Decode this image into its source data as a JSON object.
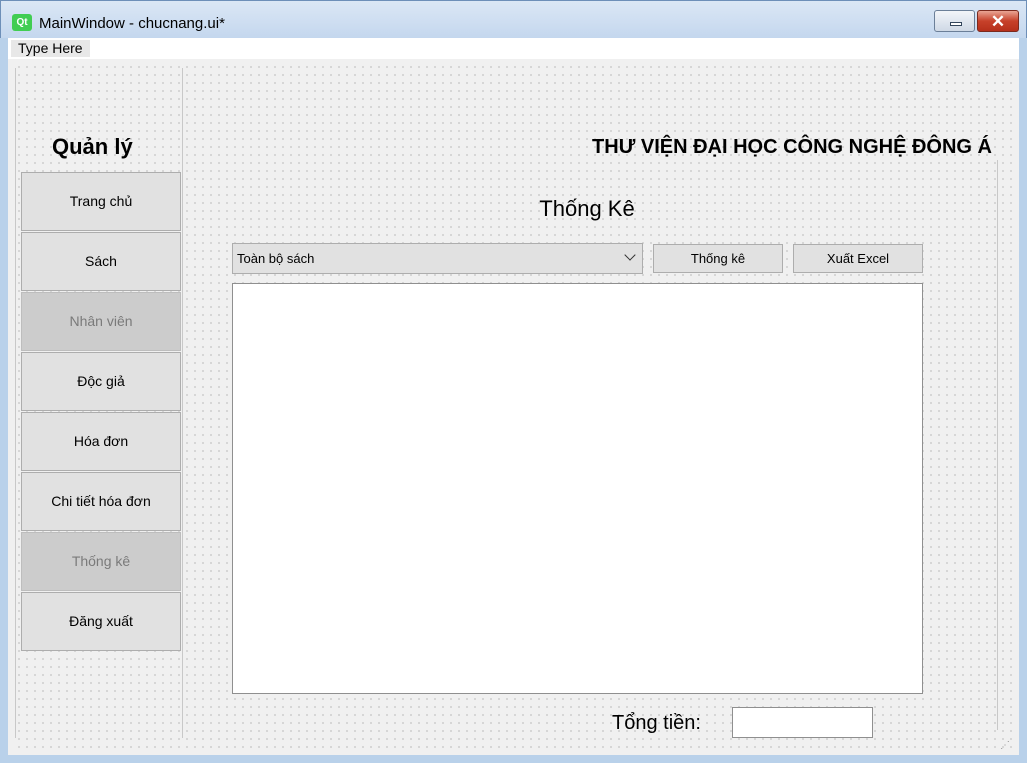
{
  "window": {
    "title": "MainWindow - chucnang.ui*",
    "app_icon_text": "Qt",
    "close_symbol": "✕",
    "colors": {
      "frame": "#b9d1ea",
      "close": "#c7412a",
      "qt_green": "#41cd52"
    }
  },
  "menubar": {
    "item": "Type Here"
  },
  "header": {
    "left": "Quản lý",
    "right": "THƯ VIỆN ĐẠI HỌC CÔNG NGHỆ ĐÔNG Á"
  },
  "sidebar": {
    "items": [
      {
        "label": "Trang chủ",
        "enabled": true
      },
      {
        "label": "Sách",
        "enabled": true
      },
      {
        "label": "Nhân viên",
        "enabled": false
      },
      {
        "label": "Độc  giả",
        "enabled": true
      },
      {
        "label": "Hóa đơn",
        "enabled": true
      },
      {
        "label": "Chi tiết hóa đơn",
        "enabled": true
      },
      {
        "label": "Thống kê",
        "enabled": false
      },
      {
        "label": "Đăng xuất",
        "enabled": true
      }
    ]
  },
  "main": {
    "title": "Thống Kê",
    "select_value": "Toàn bộ sách",
    "stats_button": "Thống kê",
    "excel_button": "Xuất Excel",
    "total_label": "Tổng tiền:",
    "total_value": ""
  }
}
